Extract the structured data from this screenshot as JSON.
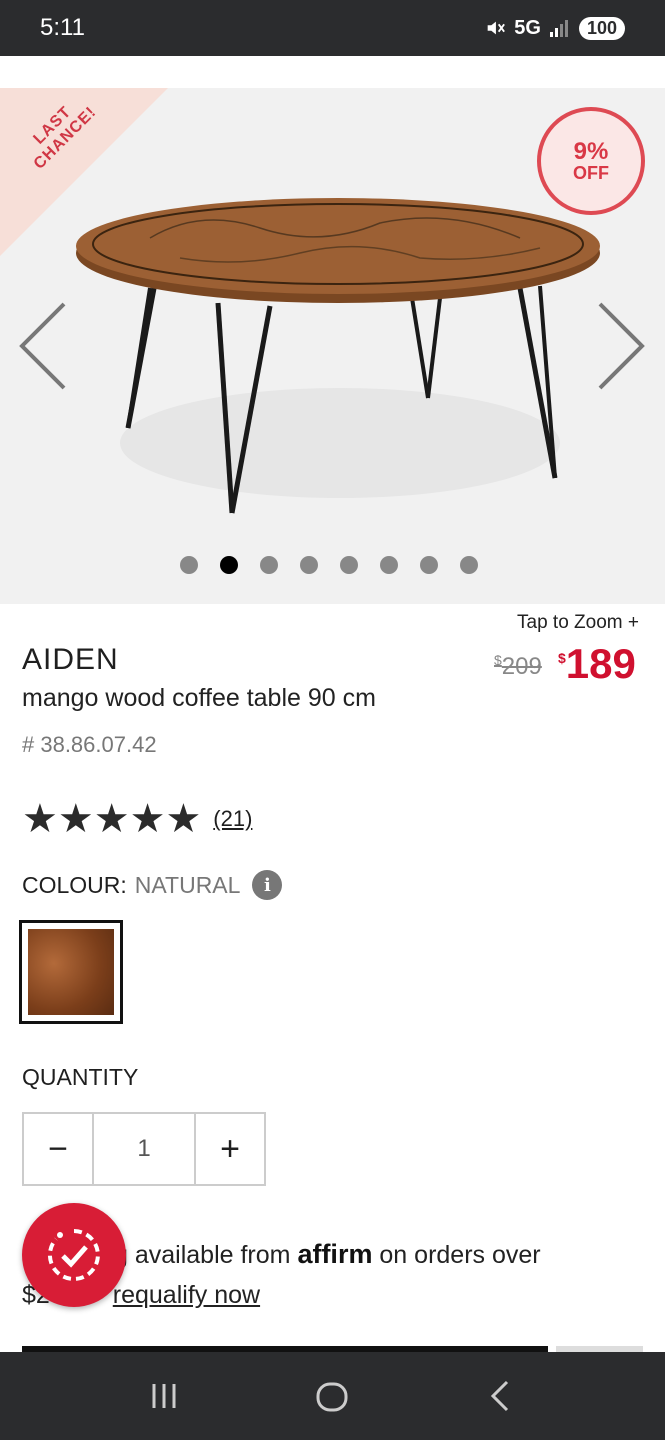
{
  "status": {
    "time": "5:11",
    "network": "5G",
    "battery": "100"
  },
  "gallery": {
    "corner_label_line1": "LAST",
    "corner_label_line2": "CHANCE!",
    "discount_pct": "9%",
    "discount_off": "OFF",
    "slides_total": 8,
    "active_slide": 2
  },
  "product": {
    "tap_to_zoom": "Tap to Zoom +",
    "brand": "AIDEN",
    "description": "mango wood coffee table 90 cm",
    "sku": "# 38.86.07.42",
    "old_price_symbol": "$",
    "old_price": "209",
    "new_price_symbol": "$",
    "new_price": "189",
    "rating_stars": "★★★★★",
    "rating_value": 5,
    "review_count": "(21)"
  },
  "colour": {
    "label": "COLOUR:",
    "value": "NATURAL",
    "info_icon": "i"
  },
  "quantity": {
    "label": "QUANTITY",
    "minus": "−",
    "value": "1",
    "plus": "+"
  },
  "affirm": {
    "prefix": "g available from",
    "logo": "affirm",
    "suffix": "on orders over",
    "line2_prefix": "$2",
    "prequalify": "requalify now"
  },
  "colors": {
    "accent": "#d0102f",
    "badge": "#de4a53",
    "corner": "#f7dfd8",
    "fab": "#d81d36"
  }
}
